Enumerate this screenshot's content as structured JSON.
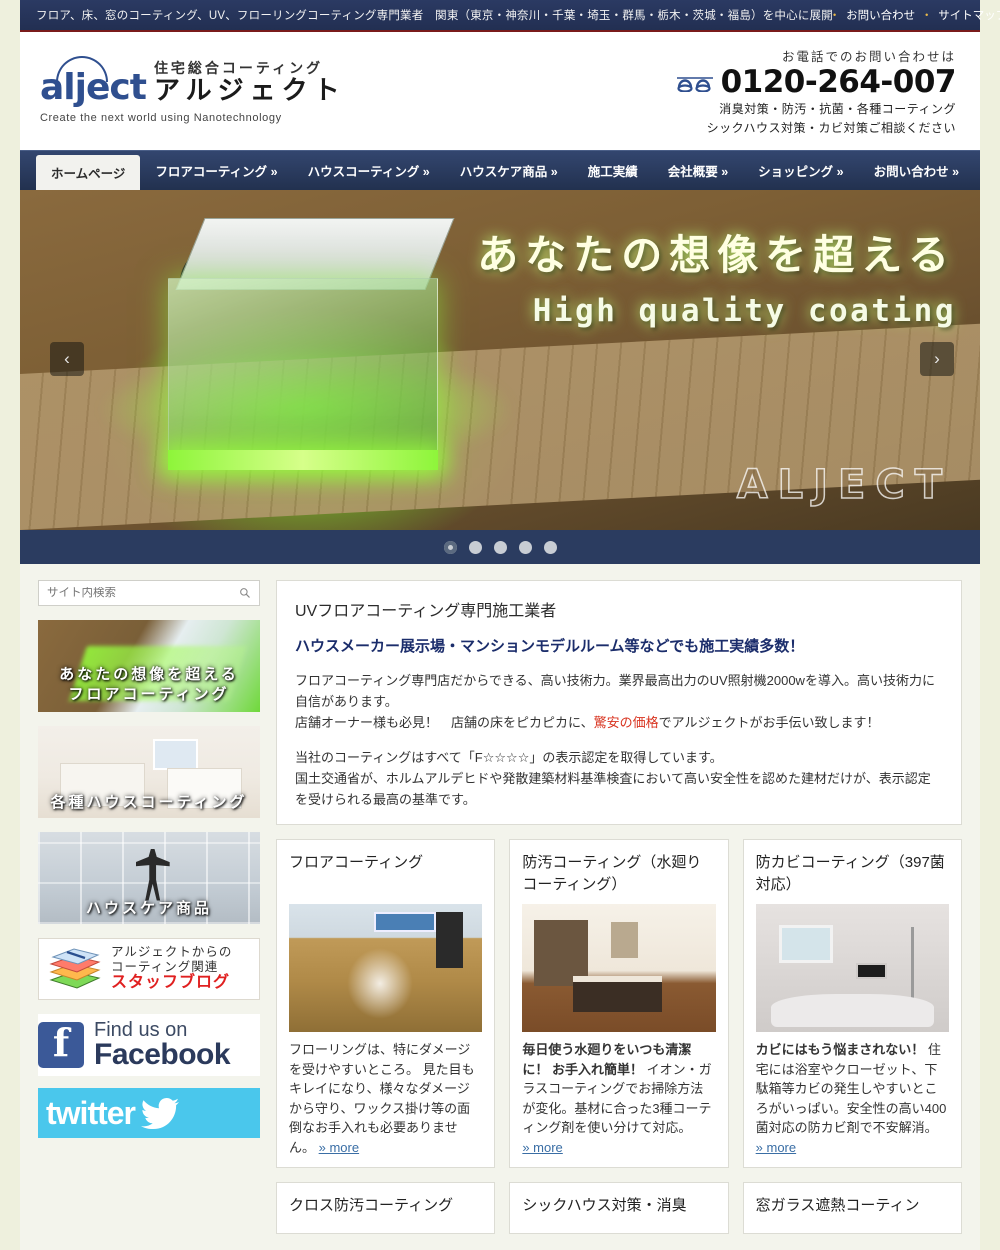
{
  "topbar": {
    "tagline": "フロア、床、窓のコーティング、UV、フローリングコーティング専門業者　関東（東京・神奈川・千葉・埼玉・群馬・栃木・茨城・福島）を中心に展開",
    "links": [
      "お問い合わせ",
      "サイトマップ"
    ],
    "bullet": "•"
  },
  "header": {
    "logo_mark": "alject",
    "logo_jp_small": "住宅総合コーティング",
    "logo_jp_big": "アルジェクト",
    "logo_tagline": "Create the next world using Nanotechnology",
    "contact_label": "お電話でのお問い合わせは",
    "phone": "0120-264-007",
    "contact_sub_line1": "消臭対策・防汚・抗菌・各種コーティング",
    "contact_sub_line2": "シックハウス対策・カビ対策ご相談ください"
  },
  "nav": {
    "items": [
      {
        "label": "ホームページ",
        "active": true
      },
      {
        "label": "フロアコーティング »",
        "active": false
      },
      {
        "label": "ハウスコーティング »",
        "active": false
      },
      {
        "label": "ハウスケア商品 »",
        "active": false
      },
      {
        "label": "施工実績",
        "active": false
      },
      {
        "label": "会社概要 »",
        "active": false
      },
      {
        "label": "ショッピング »",
        "active": false
      },
      {
        "label": "お問い合わせ »",
        "active": false
      }
    ]
  },
  "hero": {
    "title": "あなたの想像を超える",
    "subtitle": "High quality coating",
    "watermark": "ALJECT",
    "prev_arrow": "‹",
    "next_arrow": "›",
    "dot_count": 5,
    "active_dot": 0
  },
  "sidebar": {
    "search_placeholder": "サイト内検索",
    "search_value": "",
    "banners": [
      {
        "caption_line1": "あなたの想像を超える",
        "caption_line2": "フロアコーティング"
      },
      {
        "caption_line1": "各種ハウスコーティング",
        "caption_line2": ""
      },
      {
        "caption_line1": "ハウスケア商品",
        "caption_line2": ""
      }
    ],
    "blog": {
      "line1": "アルジェクトからの",
      "line2": "コーティング関連",
      "line3": "スタッフブログ"
    },
    "facebook": {
      "line1": "Find us on",
      "line2": "Facebook"
    },
    "twitter": {
      "label": "twitter"
    }
  },
  "main": {
    "intro": {
      "h1": "UVフロアコーティング専門施工業者",
      "h2": "ハウスメーカー展示場・マンションモデルルーム等などでも施工実績多数！",
      "p1_a": "フロアコーティング専門店だからできる、高い技術力。業界最高出力のUV照射機2000wを導入。高い技術力に自信があります。",
      "p1_b": "店舗オーナー様も必見！　店舗の床をピカピカに、",
      "p1_hl": "驚安の価格",
      "p1_c": "でアルジェクトがお手伝い致します！",
      "p2": "当社のコーティングはすべて「F☆☆☆☆」の表示認定を取得しています。\n国土交通省が、ホルムアルデヒドや発散建築材料基準検査において高い安全性を認めた建材だけが、表示認定を受けられる最高の基準です。"
    },
    "cards": [
      {
        "title": "フロアコーティング",
        "body_bold": "",
        "body": "フローリングは、特にダメージを受けやすいところ。\n見た目もキレイになり、様々なダメージから守り、ワックス掛け等の面倒なお手入れも必要ありません。",
        "more": "» more"
      },
      {
        "title": "防汚コーティング（水廻りコーティング）",
        "body_bold": "毎日使う水廻りをいつも清潔に！ お手入れ簡単！",
        "body": "イオン・ガラスコーティングでお掃除方法が変化。基材に合った3種コーティング剤を使い分けて対応。",
        "more": "» more"
      },
      {
        "title": "防カビコーティング（397菌対応）",
        "body_bold": "カビにはもう悩まされない！",
        "body": "住宅には浴室やクローゼット、下駄箱等カビの発生しやすいところがいっぱい。安全性の高い400菌対応の防カビ剤で不安解消。",
        "more": "» more"
      }
    ],
    "cards_row2": [
      {
        "title": "クロス防汚コーティング"
      },
      {
        "title": "シックハウス対策・消臭"
      },
      {
        "title": "窓ガラス遮熱コーティン"
      }
    ]
  }
}
